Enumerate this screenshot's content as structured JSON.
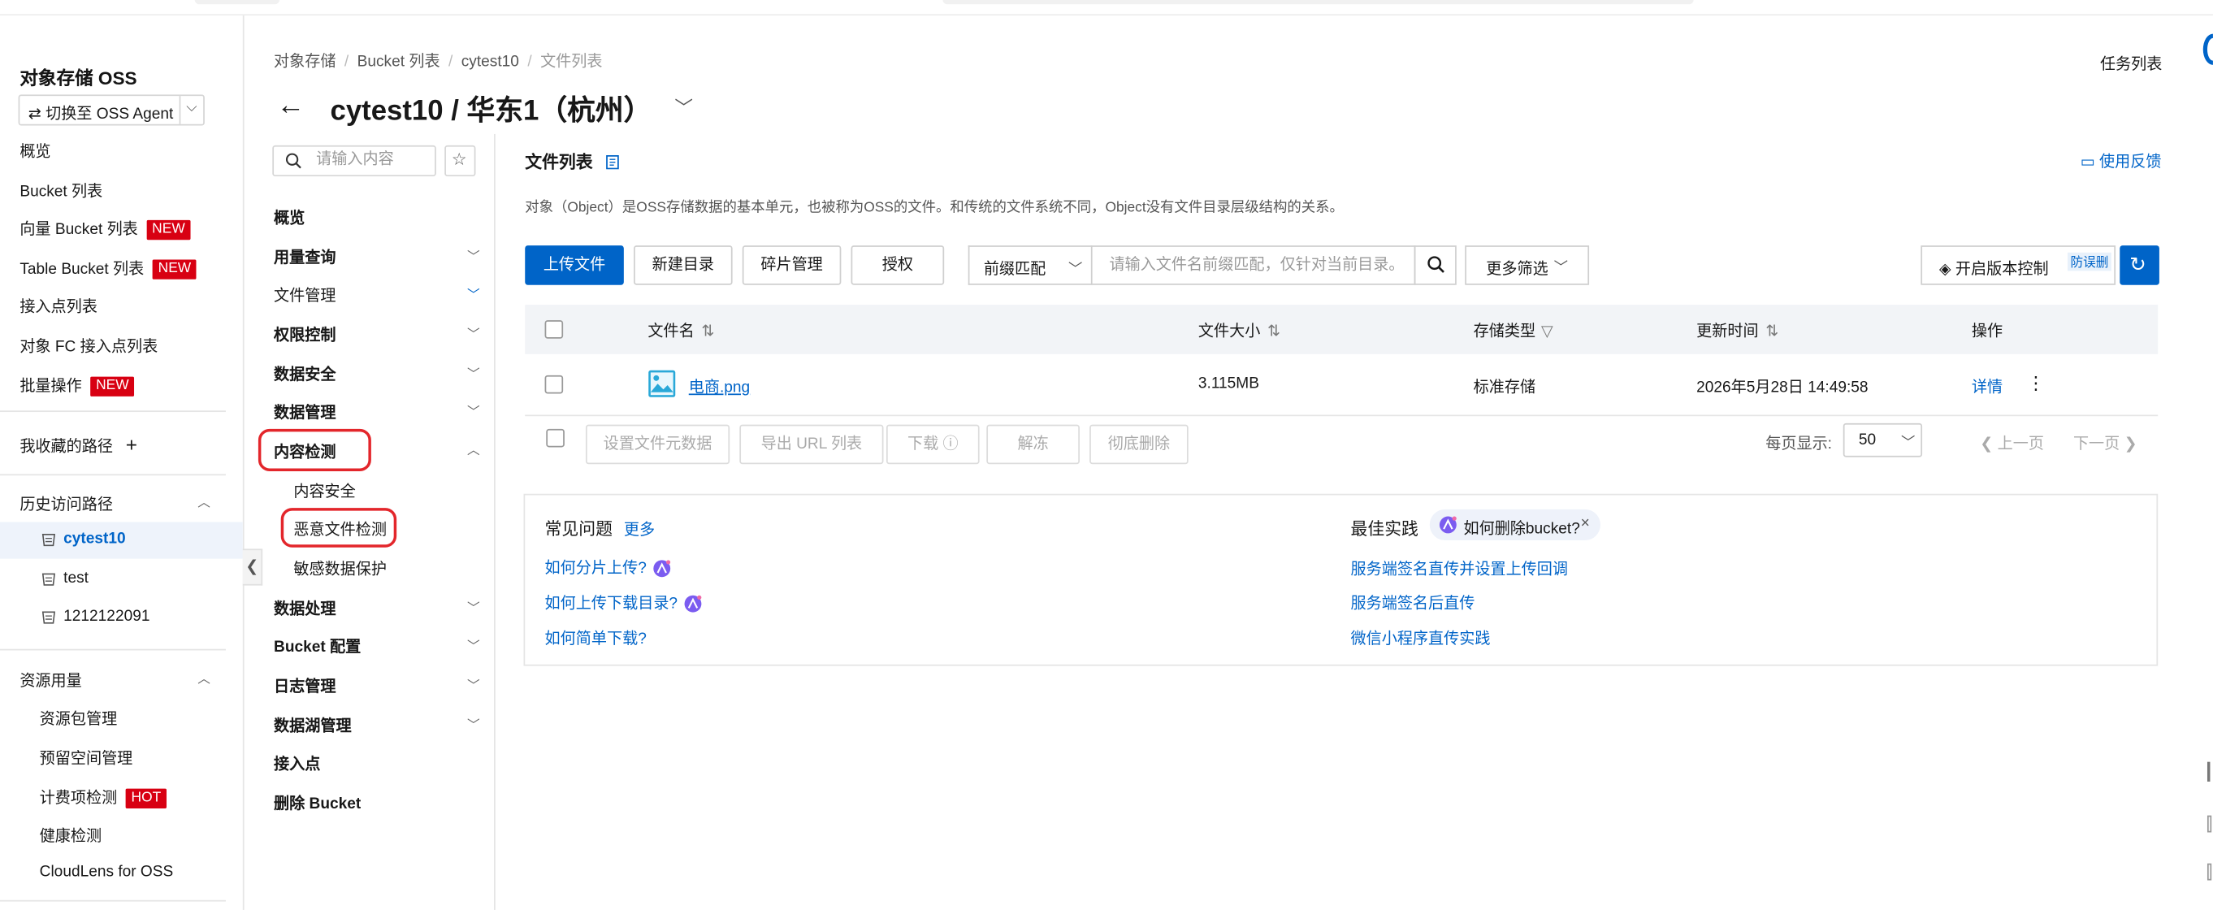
{
  "sidebar": {
    "title": "对象存储 OSS",
    "agent_button": "切换至 OSS Agent",
    "items": [
      {
        "label": "概览"
      },
      {
        "label": "Bucket 列表"
      },
      {
        "label": "向量 Bucket 列表",
        "badge": "NEW"
      },
      {
        "label": "Table Bucket 列表",
        "badge": "NEW"
      },
      {
        "label": "接入点列表"
      },
      {
        "label": "对象 FC 接入点列表"
      },
      {
        "label": "批量操作",
        "badge": "NEW"
      }
    ],
    "favorites_label": "我收藏的路径",
    "history_label": "历史访问路径",
    "history": [
      {
        "label": "cytest10"
      },
      {
        "label": "test"
      },
      {
        "label": "1212122091"
      }
    ],
    "resource_label": "资源用量",
    "resource_items": [
      {
        "label": "资源包管理"
      },
      {
        "label": "预留空间管理"
      },
      {
        "label": "计费项检测",
        "badge": "HOT"
      },
      {
        "label": "健康检测"
      },
      {
        "label": "CloudLens for OSS"
      }
    ]
  },
  "breadcrumb": [
    "对象存储",
    "Bucket 列表",
    "cytest10",
    "文件列表"
  ],
  "task_list": "任务列表",
  "page_title": "cytest10 / 华东1（杭州）",
  "bucket_nav": {
    "search_placeholder": "请输入内容",
    "items": [
      {
        "label": "概览"
      },
      {
        "label": "用量查询"
      },
      {
        "label": "文件管理"
      },
      {
        "label": "权限控制"
      },
      {
        "label": "数据安全"
      },
      {
        "label": "数据管理"
      },
      {
        "label": "内容检测"
      },
      {
        "label": "数据处理"
      },
      {
        "label": "Bucket 配置"
      },
      {
        "label": "日志管理"
      },
      {
        "label": "数据湖管理"
      },
      {
        "label": "接入点"
      },
      {
        "label": "删除 Bucket"
      }
    ],
    "content_check_sub": [
      "内容安全",
      "恶意文件检测",
      "敏感数据保护"
    ]
  },
  "main": {
    "section_title": "文件列表",
    "feedback": "使用反馈",
    "description": "对象（Object）是OSS存储数据的基本单元，也被称为OSS的文件。和传统的文件系统不同，Object没有文件目录层级结构的关系。",
    "toolbar": {
      "upload": "上传文件",
      "new_dir": "新建目录",
      "fragments": "碎片管理",
      "authorize": "授权",
      "prefix_match": "前缀匹配",
      "search_placeholder": "请输入文件名前缀匹配，仅针对当前目录。",
      "more_filter": "更多筛选",
      "versioning": "开启版本控制",
      "versioning_tag": "防误删"
    },
    "table": {
      "columns": [
        "文件名",
        "文件大小",
        "存储类型",
        "更新时间",
        "操作"
      ],
      "rows": [
        {
          "name": "电商.png",
          "size": "3.115MB",
          "storage": "标准存储",
          "updated": "2026年5月28日 14:49:58",
          "action": "详情"
        }
      ]
    },
    "batch": [
      "设置文件元数据",
      "导出 URL 列表",
      "下载",
      "解冻",
      "彻底删除"
    ],
    "pagination": {
      "label": "每页显示:",
      "page_size": "50",
      "prev": "上一页",
      "next": "下一页"
    },
    "faq": {
      "title": "常见问题",
      "more": "更多",
      "links": [
        "如何分片上传?",
        "如何上传下载目录?",
        "如何简单下载?"
      ]
    },
    "best": {
      "title": "最佳实践",
      "pill": "如何删除bucket?",
      "links": [
        "服务端签名直传并设置上传回调",
        "服务端签名后直传",
        "微信小程序直传实践"
      ]
    }
  },
  "colors": {
    "accent": "#0064c8",
    "badge": "#d80012",
    "highlight_ring": "#e3262b"
  }
}
